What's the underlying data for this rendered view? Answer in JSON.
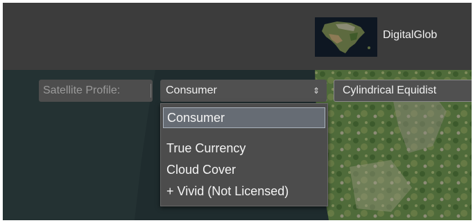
{
  "header": {
    "basemap": {
      "thumbnail_icon": "north-america-satellite-thumbnail",
      "label": "DigitalGlob"
    }
  },
  "toolbar": {
    "profile_label": "Satellite Profile:",
    "profile_value": "Consumer",
    "profile_arrows": "⇕",
    "projection_value": "Cylindrical Equidist"
  },
  "dropdown": {
    "options": [
      "Consumer",
      "True Currency",
      "Cloud Cover",
      "+ Vivid (Not Licensed)"
    ],
    "selected": "Consumer"
  },
  "colors": {
    "topbar": "#3c3c3c",
    "ocean": "#1f2c2e",
    "land": "#4f6b3a",
    "dropdown_bg": "#4c4c4c",
    "selected_bg": "#666c74"
  }
}
